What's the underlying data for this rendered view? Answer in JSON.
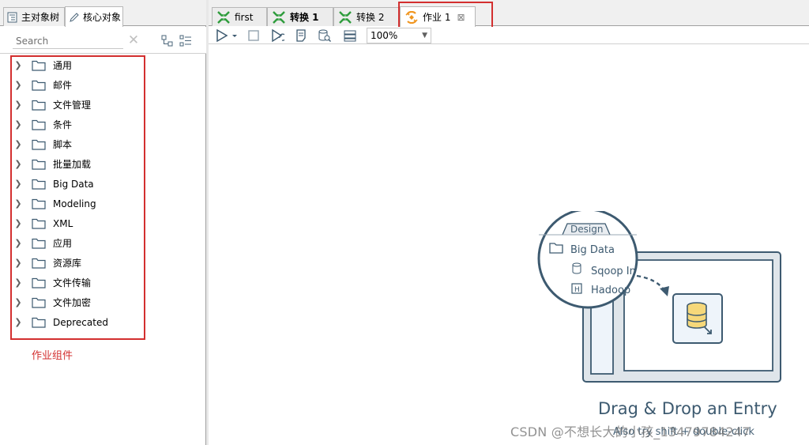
{
  "left_panel": {
    "tabs": [
      {
        "label": "主对象树",
        "icon": "tree-icon"
      },
      {
        "label": "核心对象",
        "icon": "pencil-icon"
      }
    ],
    "search": {
      "placeholder": "Search"
    },
    "tree_items": [
      {
        "label": "通用"
      },
      {
        "label": "邮件"
      },
      {
        "label": "文件管理"
      },
      {
        "label": "条件"
      },
      {
        "label": "脚本"
      },
      {
        "label": "批量加载"
      },
      {
        "label": "Big Data"
      },
      {
        "label": "Modeling"
      },
      {
        "label": "XML"
      },
      {
        "label": "应用"
      },
      {
        "label": "资源库"
      },
      {
        "label": "文件传输"
      },
      {
        "label": "文件加密"
      },
      {
        "label": "Deprecated"
      }
    ],
    "annotation": "作业组件"
  },
  "editor": {
    "tabs": [
      {
        "label": "first",
        "icon": "transformation-icon"
      },
      {
        "label": "转换 1",
        "icon": "transformation-icon"
      },
      {
        "label": "转换 2",
        "icon": "transformation-icon"
      },
      {
        "label": "作业 1",
        "icon": "job-icon",
        "active": true
      }
    ],
    "zoom": "100%",
    "illustration": {
      "design_tab": "Design",
      "folder_label": "Big Data",
      "item1": "Sqoop In",
      "item2": "Hadoop"
    },
    "drag_title": "Drag & Drop an Entry",
    "drag_hint": "Also try shift + double-click"
  },
  "watermark": "CSDN @不想长大的小孩_13479784247",
  "colors": {
    "highlight": "#d32f2f",
    "illustration_stroke": "#3d5a70",
    "transformation_icon": "#2e9c3c",
    "job_icon": "#f0951e"
  }
}
